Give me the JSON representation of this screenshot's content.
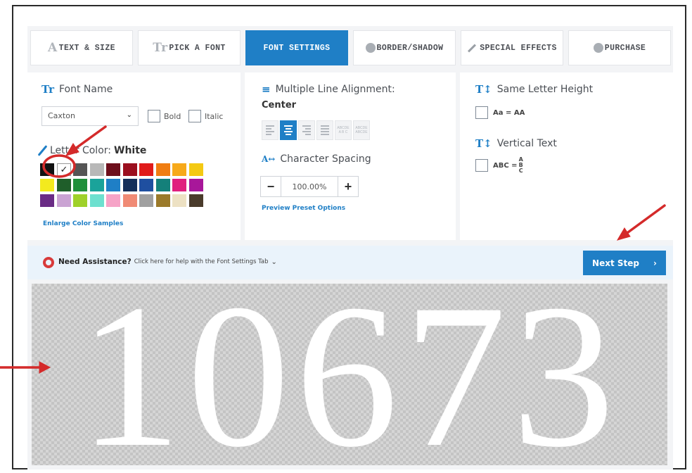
{
  "tabs": [
    {
      "label": "TEXT & SIZE",
      "icon": "text-size-icon",
      "active": false
    },
    {
      "label": "PICK A FONT",
      "icon": "font-icon",
      "active": false
    },
    {
      "label": "FONT SETTINGS",
      "icon": "",
      "active": true
    },
    {
      "label": "BORDER/SHADOW",
      "icon": "border-icon",
      "active": false
    },
    {
      "label": "SPECIAL EFFECTS",
      "icon": "wand-icon",
      "active": false
    },
    {
      "label": "PURCHASE",
      "icon": "purchase-icon",
      "active": false
    }
  ],
  "font_name": {
    "heading": "Font Name",
    "selected_font": "Caxton",
    "bold_label": "Bold",
    "italic_label": "Italic"
  },
  "letter_color": {
    "label": "Letter Color:",
    "value": "White",
    "swatches": [
      "#111111",
      "#ffffff",
      "#555555",
      "#b8b8b8",
      "#6d0e1c",
      "#9b0f1f",
      "#e01b1b",
      "#f07d12",
      "#f7a91a",
      "#f4c913",
      "#f3ea1e",
      "#1f5e2a",
      "#1f8f3a",
      "#1aa39a",
      "#1f7fc6",
      "#142f5a",
      "#1f4fa0",
      "#14807a",
      "#e0207e",
      "#a8179a",
      "#6a2b85",
      "#caa3d3",
      "#9fd12a",
      "#6de0cf",
      "#f6a3c7",
      "#f08a75",
      "#a0a0a0",
      "#9b7a2a",
      "#ede1c3",
      "#4a3b2b"
    ],
    "selected_index": 1,
    "enlarge_link": "Enlarge Color Samples"
  },
  "alignment": {
    "heading": "Multiple Line Alignment:",
    "value": "Center",
    "justify_label_1": "ABCDE",
    "justify_label_2": "A B C"
  },
  "spacing": {
    "heading": "Character Spacing",
    "minus": "−",
    "value": "100.00%",
    "plus": "+",
    "preset_link": "Preview Preset Options"
  },
  "letter_height": {
    "heading": "Same Letter Height",
    "example": "Aa = AA"
  },
  "vertical_text": {
    "heading": "Vertical Text",
    "example_left": "ABC =",
    "example_stack": [
      "A",
      "B",
      "C"
    ]
  },
  "assist": {
    "title": "Need Assistance?",
    "text": "Click here for help with the Font Settings Tab",
    "chevron": "⌄"
  },
  "next_button": {
    "label": "Next Step",
    "chevron": "›"
  },
  "preview": {
    "text": "10673"
  },
  "colors": {
    "accent": "#1f7fc6",
    "annotation": "#d42a2a"
  }
}
